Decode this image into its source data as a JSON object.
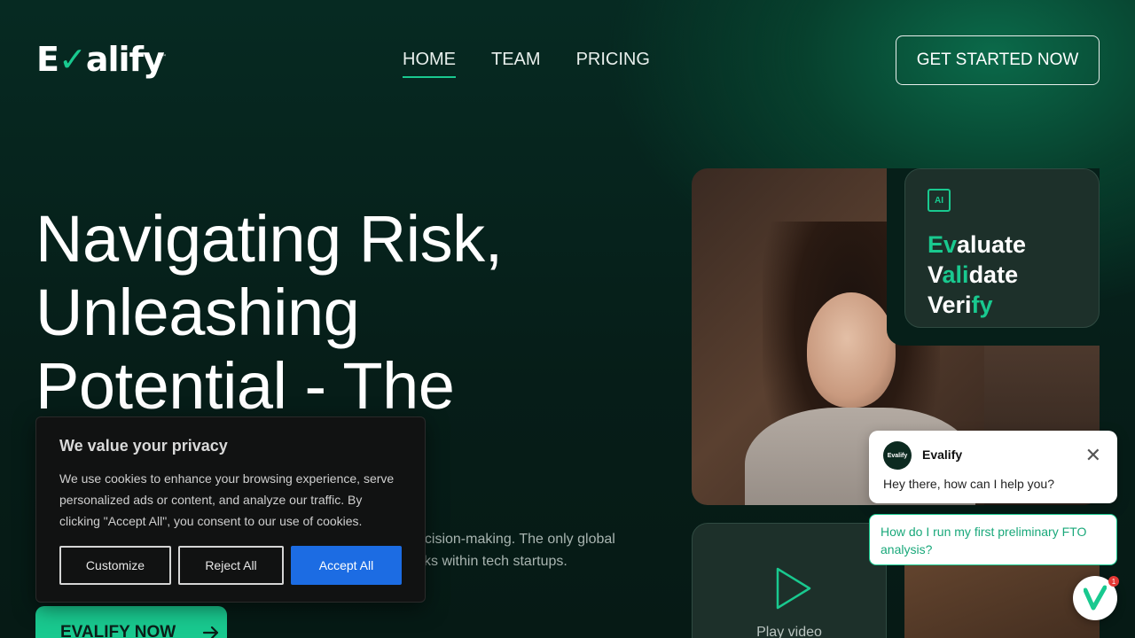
{
  "brand": {
    "logo_pre": "E",
    "logo_v": "V",
    "logo_post": "alify",
    "tm": "™",
    "accent": "#19c98f"
  },
  "nav": {
    "items": [
      {
        "label": "HOME"
      },
      {
        "label": "TEAM"
      },
      {
        "label": "PRICING"
      }
    ],
    "cta": "GET STARTED NOW"
  },
  "hero": {
    "headline_1": "Navigating Risk,",
    "headline_2": "Unleashing",
    "headline_3": "Potential - The",
    "sub_1": "ecision-making. The only global",
    "sub_2": "sks within tech startups.",
    "button": "EVALIFY NOW"
  },
  "eval_card": {
    "chip": "AI",
    "l1a": "Ev",
    "l1b": "aluate",
    "l2a": "V",
    "l2b": "ali",
    "l2c": "date",
    "l3a": "Veri",
    "l3b": "fy"
  },
  "video": {
    "label": "Play video"
  },
  "cookie": {
    "title": "We value your privacy",
    "text": "We use cookies to enhance your browsing experience, serve personalized ads or content, and analyze our traffic. By clicking \"Accept All\", you consent to our use of cookies.",
    "customize": "Customize",
    "reject": "Reject All",
    "accept": "Accept All"
  },
  "chat": {
    "avatar": "Evalify",
    "name": "Evalify",
    "message": "Hey there, how can I help you?",
    "suggestion": "How do I run my first preliminary FTO analysis?",
    "badge": "1"
  }
}
